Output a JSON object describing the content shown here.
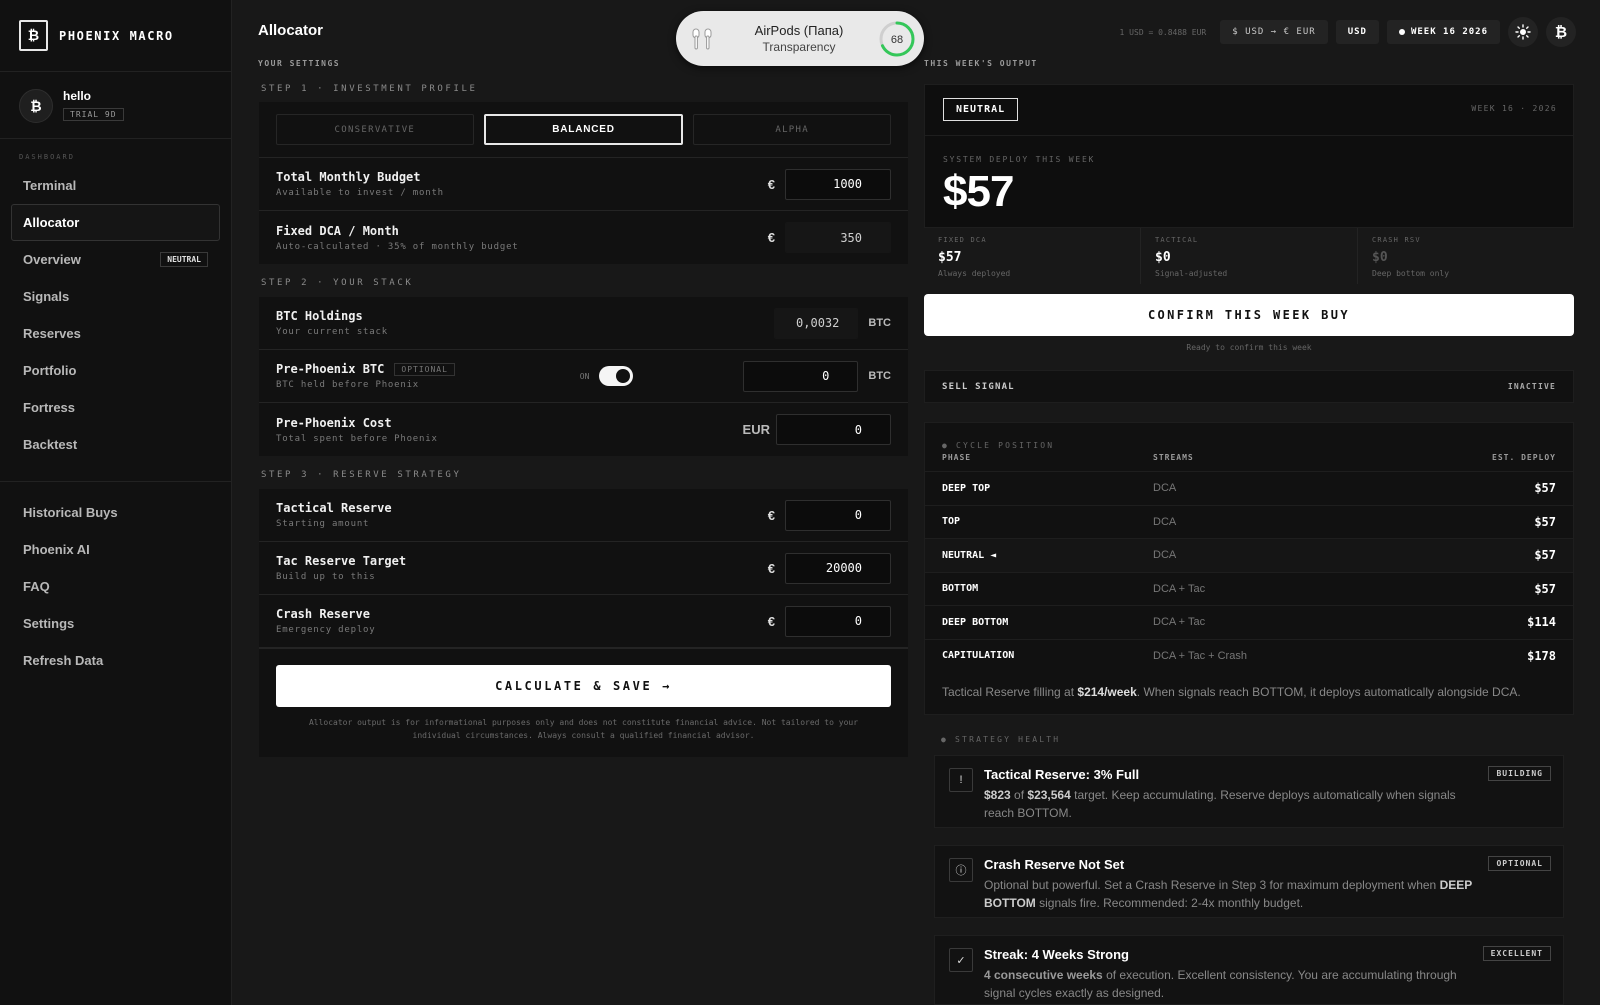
{
  "brand": {
    "logo": "₿",
    "name": "PHOENIX MACRO"
  },
  "user": {
    "avatar": "₿",
    "name": "hello",
    "plan": "TRIAL 9D"
  },
  "sidebar": {
    "section_label": "DASHBOARD",
    "items": [
      {
        "label": "Terminal",
        "badge": ""
      },
      {
        "label": "Allocator",
        "badge": ""
      },
      {
        "label": "Overview",
        "badge": "NEUTRAL"
      },
      {
        "label": "Signals",
        "badge": ""
      },
      {
        "label": "Reserves",
        "badge": ""
      },
      {
        "label": "Portfolio",
        "badge": ""
      },
      {
        "label": "Fortress",
        "badge": ""
      },
      {
        "label": "Backtest",
        "badge": ""
      }
    ],
    "secondary_items": [
      {
        "label": "Historical Buys"
      },
      {
        "label": "Phoenix AI"
      },
      {
        "label": "FAQ"
      },
      {
        "label": "Settings"
      },
      {
        "label": "Refresh Data"
      }
    ]
  },
  "header": {
    "title": "Allocator",
    "rate": "1 USD = 0.8488 EUR",
    "convert_label": "$ USD → € EUR",
    "currency": "USD",
    "week": "WEEK 16 2026",
    "theme_icon": "sun-icon",
    "account_icon": "bitcoin-icon",
    "account_glyph": "₿"
  },
  "airpods_popup": {
    "title": "AirPods (Папа)",
    "subtitle": "Transparency",
    "battery": "68",
    "battery_level": 0.68
  },
  "settings": {
    "heading": "YOUR SETTINGS",
    "step1": {
      "label": "STEP 1 · INVESTMENT PROFILE",
      "profiles": [
        "CONSERVATIVE",
        "BALANCED",
        "ALPHA"
      ],
      "selected_profile": "BALANCED",
      "budget": {
        "title": "Total Monthly Budget",
        "sub": "Available to invest / month",
        "currency": "€",
        "value": "1000"
      },
      "dca": {
        "title": "Fixed DCA / Month",
        "sub": "Auto-calculated · 35% of monthly budget",
        "currency": "€",
        "value": "350"
      }
    },
    "step2": {
      "label": "STEP 2 · YOUR STACK",
      "btc": {
        "title": "BTC Holdings",
        "sub": "Your current stack",
        "value": "0,0032",
        "unit": "BTC"
      },
      "pre_btc": {
        "title": "Pre-Phoenix BTC",
        "badge": "OPTIONAL",
        "sub": "BTC held before Phoenix",
        "toggle_label": "ON",
        "toggle_on": true,
        "value": "0",
        "unit": "BTC"
      },
      "pre_cost": {
        "title": "Pre-Phoenix Cost",
        "sub": "Total spent before Phoenix",
        "currency": "EUR",
        "value": "0"
      }
    },
    "step3": {
      "label": "STEP 3 · RESERVE STRATEGY",
      "tactical": {
        "title": "Tactical Reserve",
        "sub": "Starting amount",
        "currency": "€",
        "value": "0"
      },
      "target": {
        "title": "Tac Reserve Target",
        "sub": "Build up to this",
        "currency": "€",
        "value": "20000"
      },
      "crash": {
        "title": "Crash Reserve",
        "sub": "Emergency deploy",
        "currency": "€",
        "value": "0"
      }
    },
    "calculate_label": "CALCULATE & SAVE →",
    "disclaimer": "Allocator output is for informational purposes only and does not constitute financial advice. Not tailored to your individual circumstances. Always consult a qualified financial advisor."
  },
  "output": {
    "heading": "THIS WEEK'S OUTPUT",
    "status": "NEUTRAL",
    "week_label": "WEEK 16 · 2026",
    "deploy_label": "SYSTEM DEPLOY THIS WEEK",
    "deploy_value": "$57",
    "metrics": [
      {
        "label": "FIXED DCA",
        "value": "$57",
        "sub": "Always deployed",
        "dim": false
      },
      {
        "label": "TACTICAL",
        "value": "$0",
        "sub": "Signal-adjusted",
        "dim": false
      },
      {
        "label": "CRASH RSV",
        "value": "$0",
        "sub": "Deep bottom only",
        "dim": true
      }
    ],
    "confirm_label": "CONFIRM THIS WEEK BUY",
    "ready_text": "Ready to confirm this week",
    "sell_signal": {
      "label": "SELL SIGNAL",
      "status": "INACTIVE"
    }
  },
  "cycle": {
    "kicker": "● CYCLE POSITION",
    "headers": {
      "phase": "PHASE",
      "streams": "STREAMS",
      "deploy": "EST. DEPLOY"
    },
    "rows": [
      {
        "phase": "DEEP TOP",
        "streams": "DCA",
        "deploy": "$57",
        "current": false
      },
      {
        "phase": "TOP",
        "streams": "DCA",
        "deploy": "$57",
        "current": false
      },
      {
        "phase": "NEUTRAL ◄",
        "streams": "DCA",
        "deploy": "$57",
        "current": true
      },
      {
        "phase": "BOTTOM",
        "streams": "DCA + Tac",
        "deploy": "$57",
        "current": false
      },
      {
        "phase": "DEEP BOTTOM",
        "streams": "DCA + Tac",
        "deploy": "$114",
        "current": false
      },
      {
        "phase": "CAPITULATION",
        "streams": "DCA + Tac + Crash",
        "deploy": "$178",
        "current": false
      }
    ],
    "note_prefix": "Tactical Reserve filling at ",
    "note_rate": "$214/week",
    "note_suffix": ". When signals reach BOTTOM, it deploys automatically alongside DCA."
  },
  "health": {
    "kicker": "● STRATEGY HEALTH",
    "cards": [
      {
        "icon": "!",
        "icon_name": "alert-icon",
        "title": "Tactical Reserve: 3% Full",
        "bold1": "$823",
        "mid1": " of ",
        "bold2": "$23,564",
        "text": " target. Keep accumulating. Reserve deploys automatically when signals reach BOTTOM.",
        "badge": "BUILDING"
      },
      {
        "icon": "ⓘ",
        "icon_name": "info-icon",
        "title": "Crash Reserve Not Set",
        "text1": "Optional but powerful. Set a Crash Reserve in Step 3 for maximum deployment when ",
        "bold": "DEEP BOTTOM",
        "text2": " signals fire. Recommended: 2-4x monthly budget.",
        "badge": "OPTIONAL"
      },
      {
        "icon": "✓",
        "icon_name": "check-icon",
        "title": "Streak: 4 Weeks Strong",
        "bold": "4 consecutive weeks",
        "text": " of execution. Excellent consistency. You are accumulating through signal cycles exactly as designed.",
        "badge": "EXCELLENT"
      }
    ]
  }
}
